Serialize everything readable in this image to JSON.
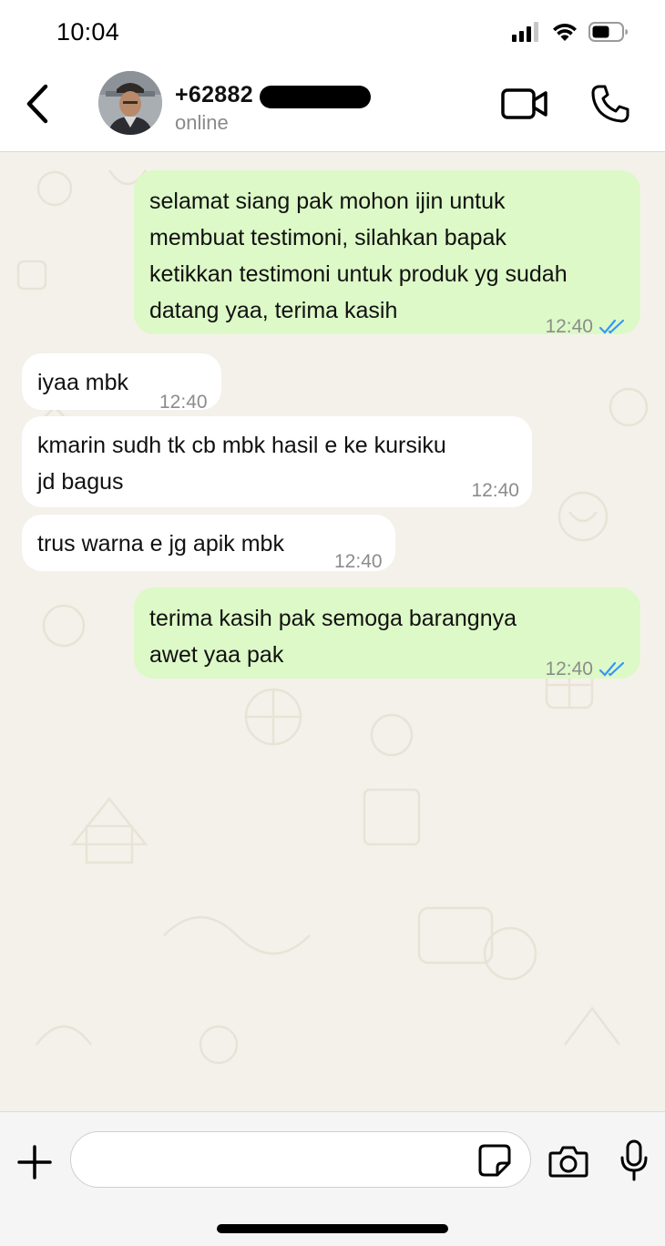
{
  "status_bar": {
    "time": "10:04",
    "icons": [
      "signal-icon",
      "wifi-icon",
      "battery-icon"
    ]
  },
  "header": {
    "back_icon": "chevron-left-icon",
    "contact_name": "+62882",
    "contact_status": "online",
    "video_icon": "video-camera-icon",
    "call_icon": "phone-icon"
  },
  "messages": [
    {
      "direction": "outgoing",
      "lines": [
        "selamat siang pak mohon ijin untuk",
        "membuat testimoni, silahkan bapak",
        "ketikkan testimoni untuk produk yg sudah",
        "datang yaa, terima kasih"
      ],
      "time": "12:40",
      "status": "read"
    },
    {
      "direction": "incoming",
      "lines": [
        "iyaa mbk"
      ],
      "time": "12:40"
    },
    {
      "direction": "incoming",
      "lines": [
        "kmarin sudh tk cb mbk hasil e ke kursiku",
        "jd bagus"
      ],
      "time": "12:40"
    },
    {
      "direction": "incoming",
      "lines": [
        "trus warna e jg apik mbk"
      ],
      "time": "12:40"
    },
    {
      "direction": "outgoing",
      "lines": [
        "terima kasih pak semoga barangnya",
        "awet yaa pak"
      ],
      "time": "12:40",
      "status": "read"
    }
  ],
  "input_bar": {
    "placeholder": "",
    "icons": [
      "plus-icon",
      "sticker-icon",
      "camera-icon",
      "microphone-icon"
    ]
  },
  "colors": {
    "outgoing_bubble": "#dcf9c7",
    "incoming_bubble": "#ffffff",
    "chat_background": "#f4f1ea",
    "read_tick": "#3497f9"
  }
}
